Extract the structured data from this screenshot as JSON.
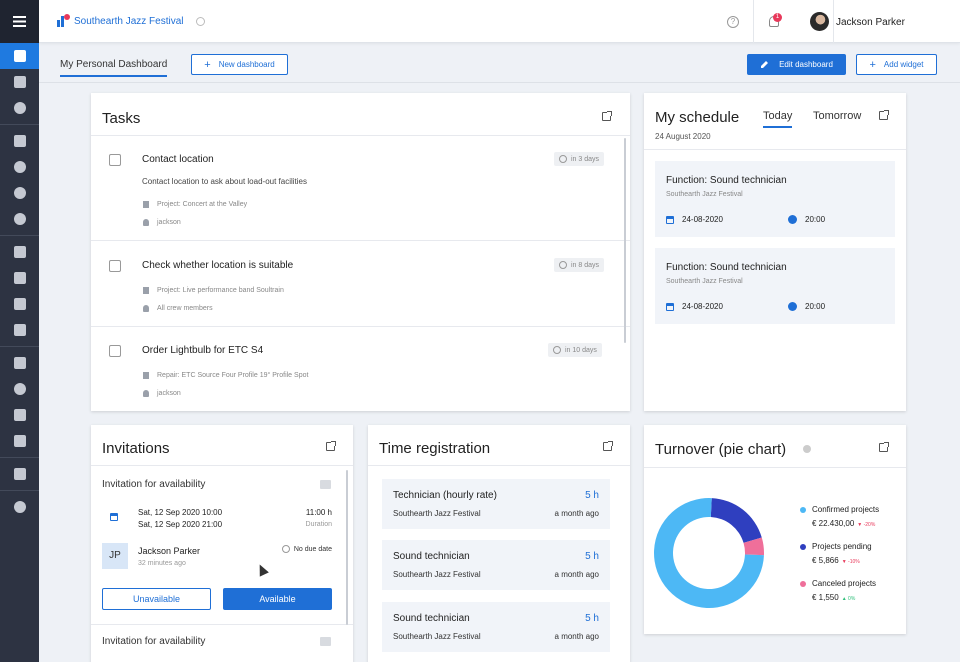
{
  "header": {
    "project": "Southearth Jazz Festival",
    "user_name": "Jackson Parker",
    "notification_count": "1"
  },
  "tabs": {
    "current": "My Personal Dashboard",
    "new_dashboard": "New dashboard",
    "edit_dashboard": "Edit dashboard",
    "add_widget": "Add widget"
  },
  "tasks": {
    "title": "Tasks",
    "items": [
      {
        "title": "Contact location",
        "description": "Contact location to ask about load-out facilities",
        "project": "Project: Concert at the Valley",
        "assignee": "jackson",
        "due": "in 3 days"
      },
      {
        "title": "Check whether location is suitable",
        "description": "",
        "project": "Project: Live performance band Soultrain",
        "assignee": "All crew members",
        "due": "in 8 days"
      },
      {
        "title": "Order Lightbulb for ETC S4",
        "description": "",
        "project": "Repair: ETC Source Four Profile 19° Profile Spot",
        "assignee": "jackson",
        "due": "in 10 days"
      }
    ]
  },
  "schedule": {
    "title": "My schedule",
    "date": "24 August 2020",
    "tab_today": "Today",
    "tab_tomorrow": "Tomorrow",
    "items": [
      {
        "title": "Function: Sound technician",
        "project": "Southearth Jazz Festival",
        "date": "24-08-2020",
        "time": "20:00"
      },
      {
        "title": "Function: Sound technician",
        "project": "Southearth Jazz Festival",
        "date": "24-08-2020",
        "time": "20:00"
      }
    ]
  },
  "invitations": {
    "title": "Invitations",
    "items": [
      {
        "title": "Invitation for availability",
        "start": "Sat, 12 Sep 2020 10:00",
        "end": "Sat, 12 Sep 2020 21:00",
        "duration": "11:00 h",
        "duration_label": "Duration",
        "initials": "JP",
        "person": "Jackson Parker",
        "ago": "32 minutes ago",
        "due": "No due date",
        "btn_unavailable": "Unavailable",
        "btn_available": "Available"
      },
      {
        "title": "Invitation for availability"
      }
    ]
  },
  "time_registration": {
    "title": "Time registration",
    "items": [
      {
        "title": "Technician (hourly rate)",
        "hours": "5 h",
        "project": "Southearth Jazz Festival",
        "ago": "a month ago"
      },
      {
        "title": "Sound technician",
        "hours": "5 h",
        "project": "Southearth Jazz Festival",
        "ago": "a month ago"
      },
      {
        "title": "Sound technician",
        "hours": "5 h",
        "project": "Southearth Jazz Festival",
        "ago": "a month ago"
      }
    ]
  },
  "turnover": {
    "title": "Turnover (pie chart)",
    "legend": [
      {
        "label": "Confirmed projects",
        "value": "€ 22.430,00",
        "change": "▼ -20%",
        "color": "#4db8f5",
        "change_color": "#e8395b"
      },
      {
        "label": "Projects pending",
        "value": "€ 5,866",
        "change": "▼ -10%",
        "color": "#2f3fbf",
        "change_color": "#e8395b"
      },
      {
        "label": "Canceled projects",
        "value": "€ 1,550",
        "change": "▲ 0%",
        "color": "#ef6f9a",
        "change_color": "#2fbf7a"
      }
    ]
  },
  "chart_data": {
    "type": "pie",
    "categories": [
      "Confirmed projects",
      "Projects pending",
      "Canceled projects"
    ],
    "values": [
      22430,
      5866,
      1550
    ],
    "colors": [
      "#4db8f5",
      "#2f3fbf",
      "#ef6f9a"
    ],
    "donut": true,
    "legend_position": "right"
  }
}
